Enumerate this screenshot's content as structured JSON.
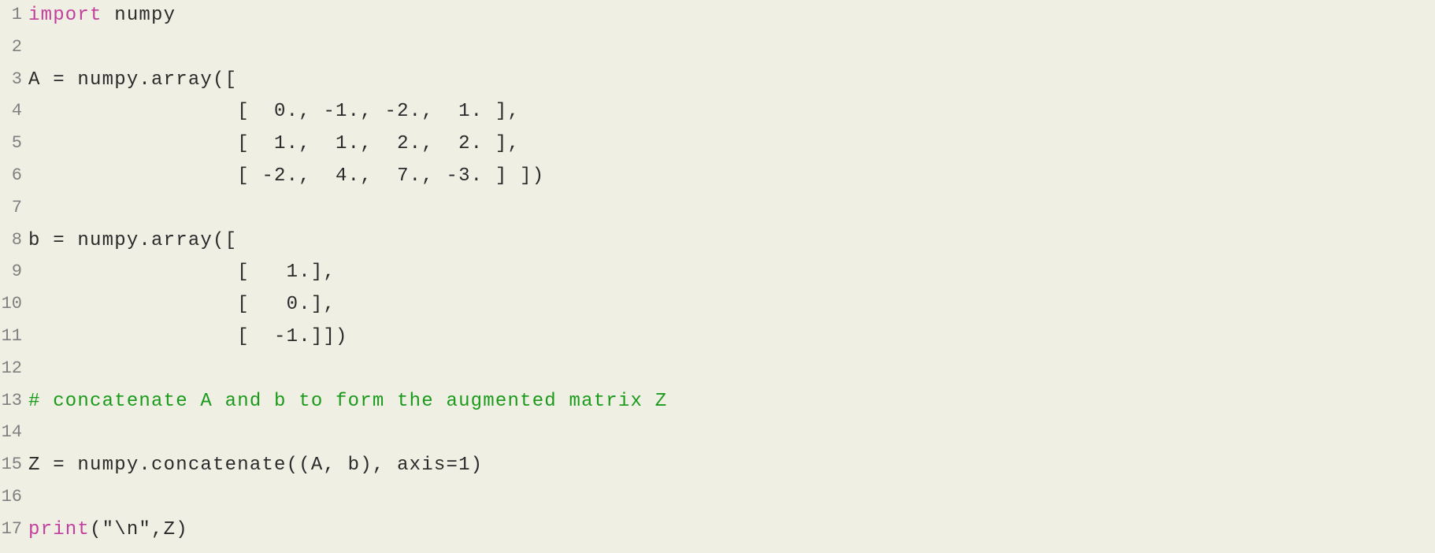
{
  "code": {
    "lines": [
      {
        "num": "1",
        "segments": [
          {
            "cls": "kw",
            "t": "import"
          },
          {
            "cls": "nm",
            "t": " numpy"
          }
        ]
      },
      {
        "num": "2",
        "segments": []
      },
      {
        "num": "3",
        "segments": [
          {
            "cls": "nm",
            "t": "A = numpy.array(["
          }
        ]
      },
      {
        "num": "4",
        "segments": [
          {
            "cls": "nm",
            "t": "                 [  0., -1., -2.,  1. ],"
          }
        ]
      },
      {
        "num": "5",
        "segments": [
          {
            "cls": "nm",
            "t": "                 [  1.,  1.,  2.,  2. ],"
          }
        ]
      },
      {
        "num": "6",
        "segments": [
          {
            "cls": "nm",
            "t": "                 [ -2.,  4.,  7., -3. ] ])"
          }
        ]
      },
      {
        "num": "7",
        "segments": []
      },
      {
        "num": "8",
        "segments": [
          {
            "cls": "nm",
            "t": "b = numpy.array(["
          }
        ]
      },
      {
        "num": "9",
        "segments": [
          {
            "cls": "nm",
            "t": "                 [   1.],"
          }
        ]
      },
      {
        "num": "10",
        "segments": [
          {
            "cls": "nm",
            "t": "                 [   0.],"
          }
        ]
      },
      {
        "num": "11",
        "segments": [
          {
            "cls": "nm",
            "t": "                 [  -1.]])"
          }
        ]
      },
      {
        "num": "12",
        "segments": []
      },
      {
        "num": "13",
        "segments": [
          {
            "cls": "cm",
            "t": "# concatenate A and b to form the augmented matrix Z"
          }
        ]
      },
      {
        "num": "14",
        "segments": []
      },
      {
        "num": "15",
        "segments": [
          {
            "cls": "nm",
            "t": "Z = numpy.concatenate((A, b), axis=1)"
          }
        ]
      },
      {
        "num": "16",
        "segments": []
      },
      {
        "num": "17",
        "segments": [
          {
            "cls": "fn",
            "t": "print"
          },
          {
            "cls": "nm",
            "t": "(\"\\n\",Z)"
          }
        ]
      }
    ]
  },
  "colors": {
    "background": "#f0efe4",
    "gutter": "#808080",
    "keyword": "#c23f9e",
    "comment": "#1a9a1a",
    "text": "#2a2a2a"
  }
}
